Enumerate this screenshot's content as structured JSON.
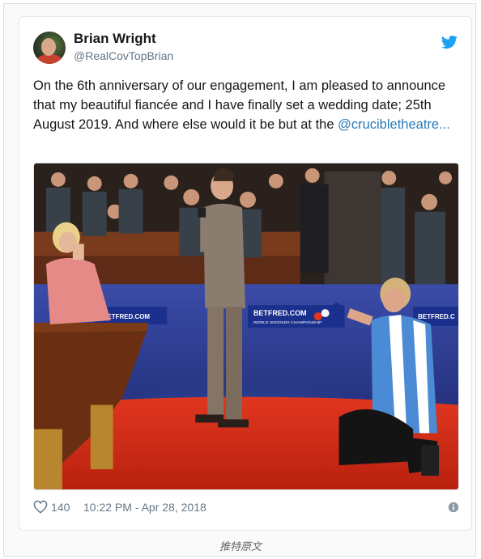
{
  "tweet": {
    "author_name": "Brian Wright",
    "author_handle": "@RealCovTopBrian",
    "text_part1": "On the 6th anniversary of our engagement, I am pleased to announce that my beautiful fiancée and I have finally set a wedding date; 25th August 2019. And where else would it be but at the ",
    "mention": "@crucibletheatre...",
    "likes": "140",
    "timestamp": "10:22 PM - Apr 28, 2018",
    "photo_alt": "Man kneeling proposing on snooker stage",
    "icons": {
      "like": "heart-icon",
      "brand": "twitter-bird-icon",
      "info": "info-icon"
    }
  },
  "banners": {
    "left": "BETFRED.COM",
    "middle": "BETFRED.COM",
    "middle_sub": "WORLD SNOOKER CHAMPIONSHIP",
    "right": "BETFRED.C"
  },
  "caption": "推特原文",
  "colors": {
    "twitter_blue": "#1da1f2",
    "mention": "#2b7bb9",
    "text": "#14171a",
    "muted": "#657786"
  }
}
